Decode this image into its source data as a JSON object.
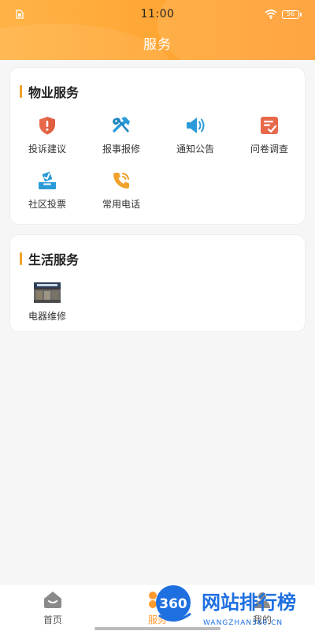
{
  "status_bar": {
    "time": "11:00",
    "battery": "56"
  },
  "header": {
    "title": "服务"
  },
  "sections": [
    {
      "title": "物业服务",
      "items": [
        {
          "label": "投诉建议",
          "icon": "shield-icon",
          "color": "#e8694a"
        },
        {
          "label": "报事报修",
          "icon": "tools-icon",
          "color": "#2a9bd8"
        },
        {
          "label": "通知公告",
          "icon": "speaker-icon",
          "color": "#2a9bd8"
        },
        {
          "label": "问卷调查",
          "icon": "survey-icon",
          "color": "#e8694a"
        },
        {
          "label": "社区投票",
          "icon": "vote-icon",
          "color": "#2a9bd8"
        },
        {
          "label": "常用电话",
          "icon": "phone-icon",
          "color": "#f0a22d"
        }
      ]
    },
    {
      "title": "生活服务",
      "items": [
        {
          "label": "电器维修",
          "icon": "storefront-icon"
        }
      ]
    }
  ],
  "bottom_nav": {
    "items": [
      {
        "label": "首页",
        "icon": "home-icon"
      },
      {
        "label": "服务",
        "icon": "service-icon",
        "active": true
      },
      {
        "label": "我的",
        "icon": "profile-icon"
      }
    ]
  },
  "watermark": {
    "text": "网站排行榜",
    "number": "360",
    "sub": "WANGZHAN360.CN"
  }
}
